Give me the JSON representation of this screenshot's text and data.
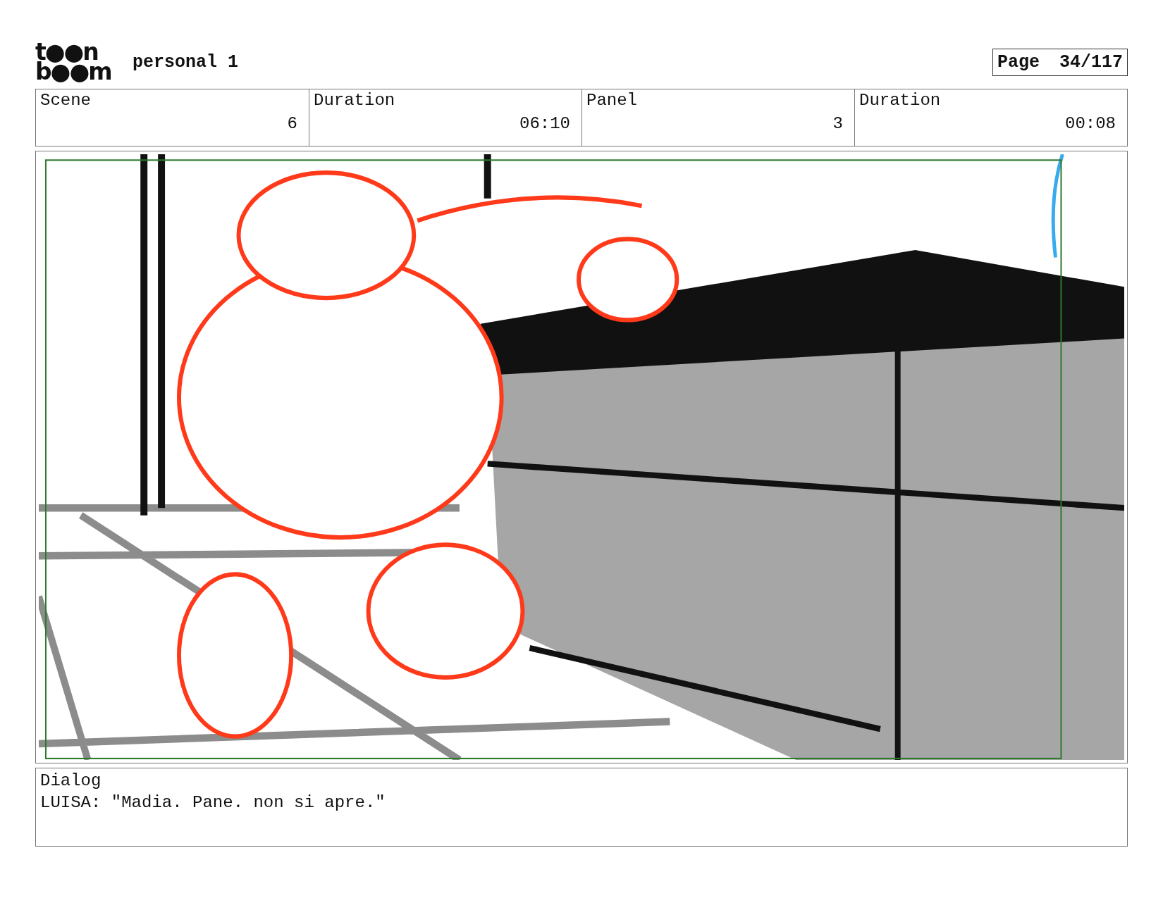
{
  "header": {
    "logo": [
      "t●●n",
      "b●●m"
    ],
    "title": "personal 1",
    "page_label": "Page",
    "page_number": "34/117"
  },
  "info_table": [
    {
      "label": "Scene",
      "value": "6"
    },
    {
      "label": "Duration",
      "value": "06:10"
    },
    {
      "label": "Panel",
      "value": "3"
    },
    {
      "label": "Duration",
      "value": "00:08"
    }
  ],
  "dialog": {
    "label": "Dialog",
    "text": "LUISA: \"Madia. Pane. non si apre.\""
  }
}
